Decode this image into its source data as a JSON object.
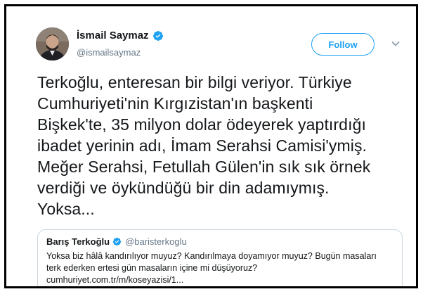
{
  "author": {
    "name": "İsmail Saymaz",
    "handle": "@ismailsaymaz"
  },
  "follow_button": {
    "label": "Follow"
  },
  "tweet": {
    "lines": [
      "Terkoğlu, enteresan bir bilgi veriyor. Türkiye",
      "Cumhuriyeti'nin Kırgızistan'ın başkenti",
      "Bişkek'te, 35 milyon dolar ödeyerek yaptırdığı",
      "ibadet yerinin adı, İmam Serahsi Camisi'ymiş.",
      "Meğer Serahsi, Fetullah Gülen'in sık sık örnek",
      "verdiği ve öykündüğü bir din adamıymış.",
      "Yoksa..."
    ]
  },
  "quoted_tweet": {
    "name": "Barış Terkoğlu",
    "handle": "@baristerkoglu",
    "lines": [
      "Yoksa biz hâlâ kandırılıyor muyuz? Kandırılmaya doyamıyor muyuz? Bugün masaları",
      "terk ederken ertesi gün masaların içine mi düşüyoruz?",
      "cumhuriyet.com.tr/m/koseyazisi/1..."
    ]
  },
  "icons": {
    "verified": "verified-badge-icon",
    "more": "chevron-down-icon"
  },
  "colors": {
    "accent": "#1da1f2",
    "secondary_text": "#657786",
    "border": "#ccd6dd"
  }
}
